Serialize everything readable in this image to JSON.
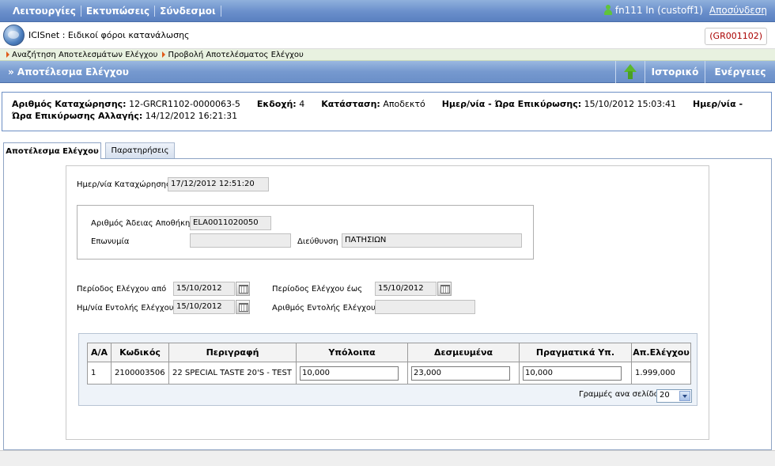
{
  "topbar": {
    "menu": [
      "Λειτουργίες",
      "Εκτυπώσεις",
      "Σύνδεσμοι"
    ],
    "user": "fn111 ln (custoff1)",
    "logout": "Αποσύνδεση"
  },
  "app": {
    "title": "ICISnet : Ειδικοί φόροι κατανάλωσης",
    "code": "(GR001102)"
  },
  "breadcrumb": [
    "Αναζήτηση Αποτελεσμάτων Ελέγχου",
    "Προβολή Αποτελέσματος Ελέγχου"
  ],
  "page": {
    "heading": "» Αποτέλεσμα Ελέγχου",
    "actions": [
      "Ιστορικό",
      "Ενέργειες"
    ]
  },
  "info": {
    "reg_label": "Αριθμός Καταχώρησης:",
    "reg_value": "12-GRCR1102-0000063-5",
    "version_label": "Εκδοχή:",
    "version_value": "4",
    "status_label": "Κατάσταση:",
    "status_value": "Αποδεκτό",
    "confirm_label": "Ημερ/νία - Ώρα Επικύρωσης:",
    "confirm_value": "15/10/2012 15:03:41",
    "change_label_1": "Ημερ/νία -",
    "change_label_2": "Ώρα Επικύρωσης Αλλαγής:",
    "change_value": "14/12/2012 16:21:31"
  },
  "tabs": [
    "Αποτέλεσμα Ελέγχου",
    "Παρατηρήσεις"
  ],
  "form": {
    "reg_date_label": "Ημερ/νία Καταχώρησης",
    "reg_date_value": "17/12/2012 12:51:20",
    "license_label": "Αριθμός Άδειας Αποθήκης",
    "license_value": "ELA0011020050",
    "name_label": "Επωνυμία",
    "name_value": "",
    "address_label": "Διεύθυνση",
    "address_value": "ΠΑΤΗΣΙΩΝ",
    "period_from_label": "Περίοδος Ελέγχου από",
    "period_from_value": "15/10/2012",
    "period_to_label": "Περίοδος Ελέγχου έως",
    "period_to_value": "15/10/2012",
    "order_date_label": "Ημ/νία Εντολής Ελέγχου",
    "order_date_value": "15/10/2012",
    "order_no_label": "Αριθμός Εντολής Ελέγχου",
    "order_no_value": ""
  },
  "grid": {
    "headers": [
      "Α/Α",
      "Κωδικός",
      "Περιγραφή",
      "Υπόλοιπα",
      "Δεσμευμένα",
      "Πραγματικά Υπ.",
      "Απ.Ελέγχου"
    ],
    "rows": [
      [
        "1",
        "2100003506",
        "22 SPECIAL TASTE 20'S - TEST",
        "10,000",
        "23,000",
        "10,000",
        "1.999,000"
      ]
    ],
    "rows_per_page_label": "Γραμμές ανα σελίδα:",
    "rows_per_page_value": "20"
  }
}
